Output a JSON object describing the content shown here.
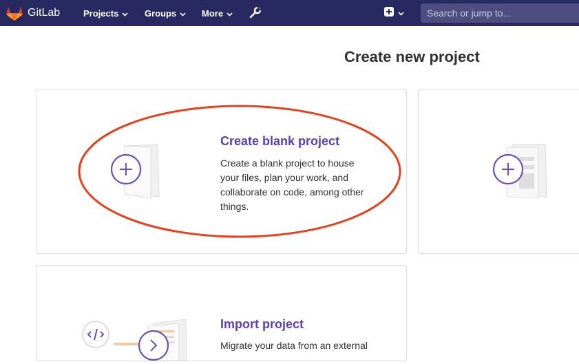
{
  "navbar": {
    "brand": "GitLab",
    "items": [
      {
        "label": "Projects"
      },
      {
        "label": "Groups"
      },
      {
        "label": "More"
      }
    ],
    "search_placeholder": "Search or jump to...",
    "bg_color": "#292961"
  },
  "page": {
    "title": "Create new project"
  },
  "cards": {
    "blank": {
      "title": "Create blank project",
      "description_lines": [
        "Create a blank project to house",
        "your files, plan your work, and",
        "collaborate on code, among other",
        "things."
      ]
    },
    "import": {
      "title": "Import project",
      "description_partial": "Migrate your data from an external"
    }
  },
  "accent_color": "#5b3fb5",
  "annotation_color": "#e8401c"
}
